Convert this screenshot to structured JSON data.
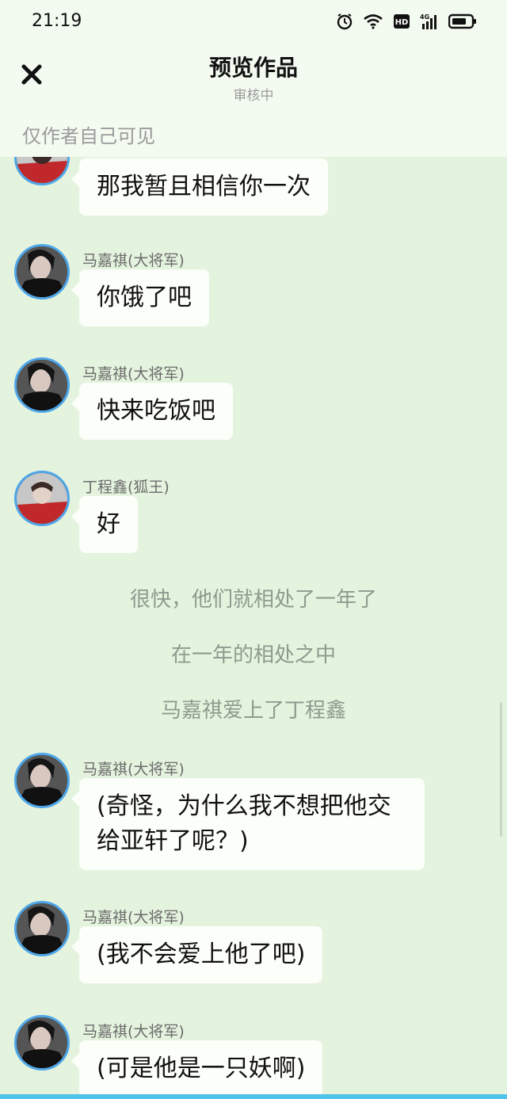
{
  "status_bar": {
    "time": "21:19",
    "icons": [
      "alarm-icon",
      "wifi-icon",
      "hd-icon",
      "signal-4g-icon",
      "battery-icon"
    ]
  },
  "header": {
    "title": "预览作品",
    "subtitle": "审核中",
    "notice": "仅作者自己可见"
  },
  "messages": [
    {
      "sender": "",
      "text": "那我暂且相信你一次",
      "avatar": "dingchengxin"
    },
    {
      "sender": "马嘉祺(大将军)",
      "text": "你饿了吧",
      "avatar": "majiaqi"
    },
    {
      "sender": "马嘉祺(大将军)",
      "text": "快来吃饭吧",
      "avatar": "majiaqi"
    },
    {
      "sender": "丁程鑫(狐王)",
      "text": "好",
      "avatar": "dingchengxin"
    },
    {
      "sender": "马嘉祺(大将军)",
      "text": "(奇怪，为什么我不想把他交给亚轩了呢？)",
      "avatar": "majiaqi"
    },
    {
      "sender": "马嘉祺(大将军)",
      "text": "(我不会爱上他了吧)",
      "avatar": "majiaqi"
    },
    {
      "sender": "马嘉祺(大将军)",
      "text": "(可是他是一只妖啊)",
      "avatar": "majiaqi"
    }
  ],
  "narration": [
    "很快，他们就相处了一年了",
    "在一年的相处之中",
    "马嘉祺爱上了丁程鑫"
  ],
  "colors": {
    "background": "#e4f3de",
    "bubble": "#fbfef9",
    "avatar_ring": "#4ea6e8",
    "accent_strip": "#4fc3e9"
  }
}
